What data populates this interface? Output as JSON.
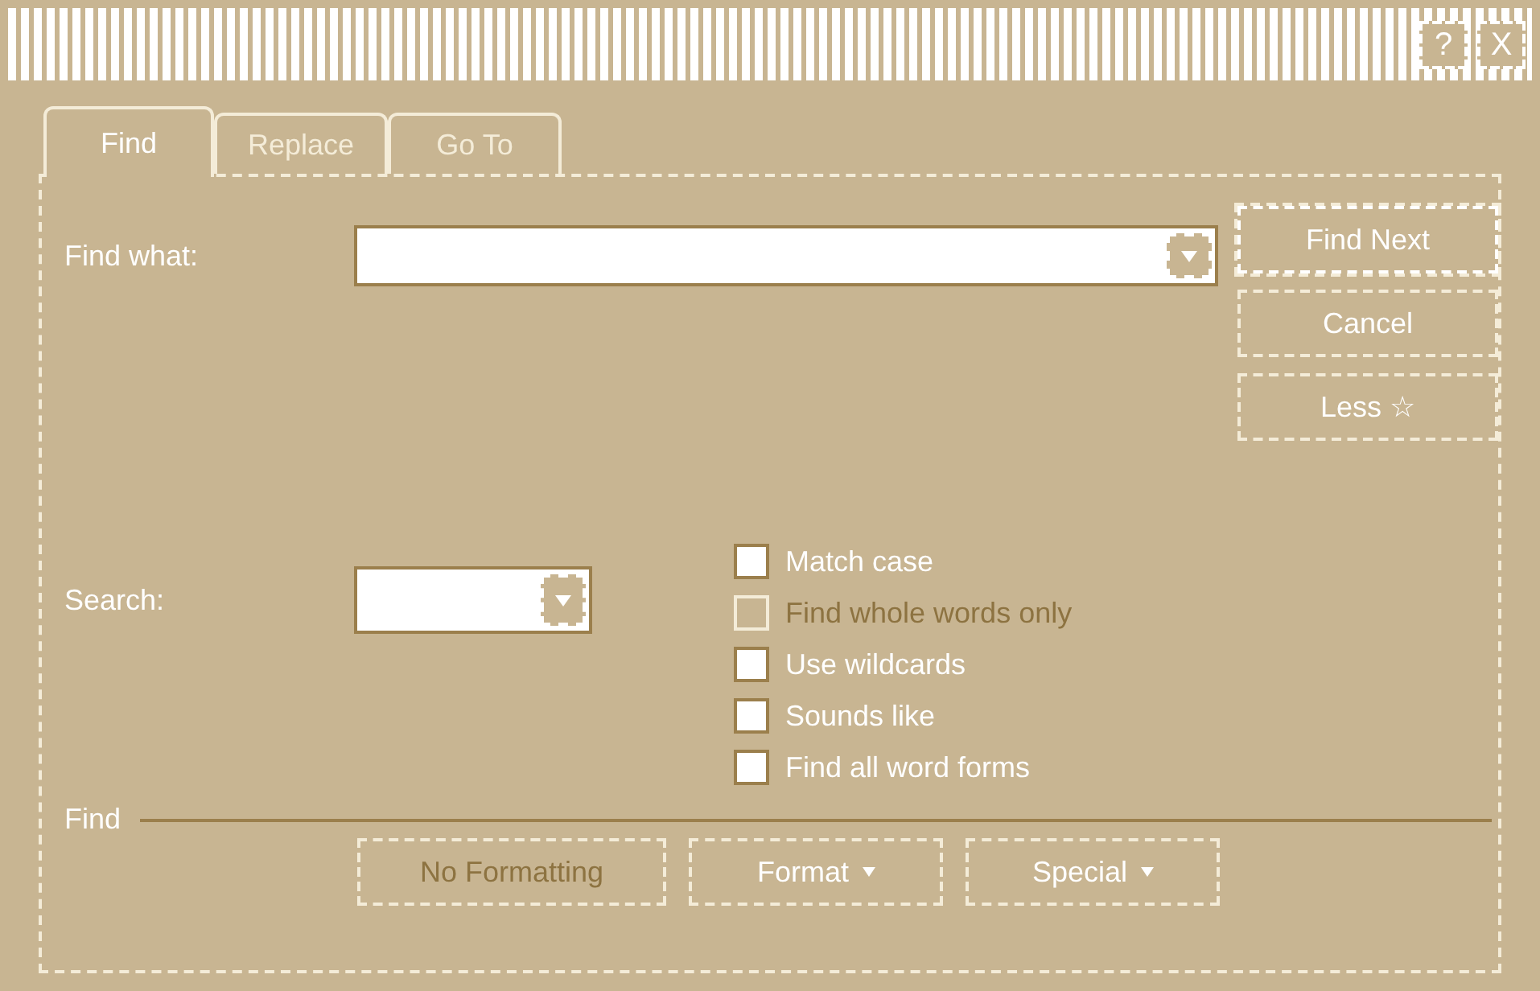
{
  "title_bar": {
    "buttons": [
      "?",
      "X"
    ]
  },
  "tabs": [
    {
      "label": "Find",
      "selected": true
    },
    {
      "label": "Replace",
      "selected": false
    },
    {
      "label": "Go To",
      "selected": false
    }
  ],
  "find_what": {
    "label": "Find what:"
  },
  "side_buttons": [
    {
      "label": "Find Next",
      "default": true
    },
    {
      "label": "Cancel",
      "default": false
    },
    {
      "label": "Less ☆",
      "default": false
    }
  ],
  "search": {
    "label": "Search:"
  },
  "options": [
    {
      "label": "Match case",
      "checked": false,
      "disabled": false
    },
    {
      "label": "Find whole words only",
      "checked": false,
      "disabled": true
    },
    {
      "label": "Use wildcards",
      "checked": false,
      "disabled": false
    },
    {
      "label": "Sounds like",
      "checked": false,
      "disabled": false
    },
    {
      "label": "Find all word forms",
      "checked": false,
      "disabled": false
    }
  ],
  "find_section": {
    "label": "Find"
  },
  "bottom_buttons": [
    {
      "label": "No Formatting",
      "disabled": true,
      "dropdown": false
    },
    {
      "label": "Format",
      "disabled": false,
      "dropdown": true
    },
    {
      "label": "Special",
      "disabled": false,
      "dropdown": true
    }
  ]
}
